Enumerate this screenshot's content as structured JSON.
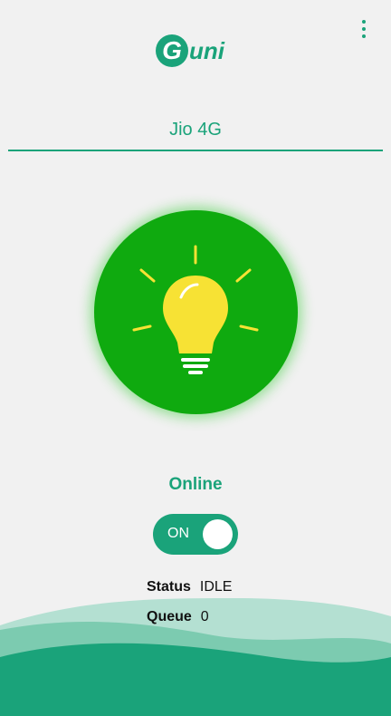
{
  "app": {
    "logo_text": "Guni",
    "menu_icon": "more-vert-icon"
  },
  "network": {
    "name": "Jio 4G"
  },
  "power_button": {
    "icon": "lightbulb-icon",
    "color": "#0faa0f",
    "bulb_color": "#f7e234"
  },
  "connection": {
    "state": "Online"
  },
  "toggle": {
    "label": "ON",
    "on": true
  },
  "info": {
    "status_label": "Status",
    "status_value": "IDLE",
    "queue_label": "Queue",
    "queue_value": "0"
  },
  "colors": {
    "accent": "#1aa37a",
    "background": "#f1f1f1"
  }
}
